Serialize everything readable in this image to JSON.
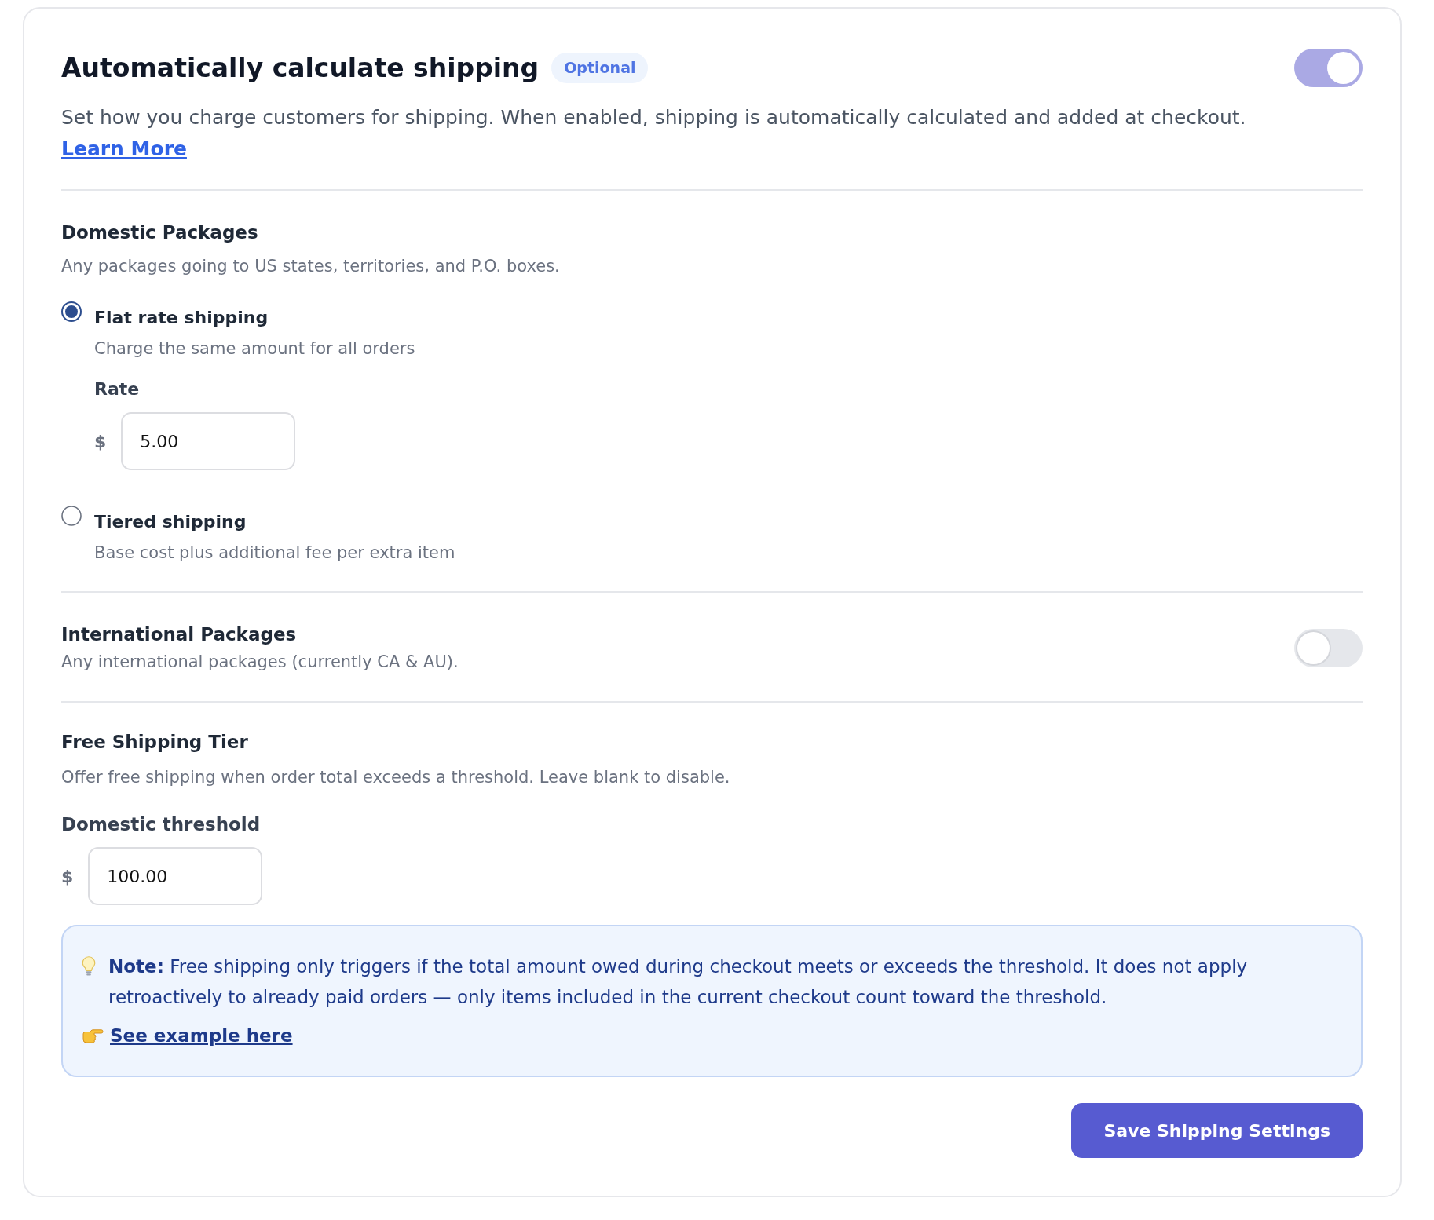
{
  "header": {
    "title": "Automatically calculate shipping",
    "badge": "Optional",
    "enabled": true
  },
  "description": {
    "text": "Set how you charge customers for shipping. When enabled, shipping is automatically calculated and added at checkout.",
    "link": "Learn More"
  },
  "domestic": {
    "title": "Domestic Packages",
    "subtitle": "Any packages going to US states, territories, and P.O. boxes.",
    "options": [
      {
        "label": "Flat rate shipping",
        "hint": "Charge the same amount for all orders",
        "selected": true,
        "rate": {
          "label": "Rate",
          "currency": "$",
          "value": "5.00"
        }
      },
      {
        "label": "Tiered shipping",
        "hint": "Base cost plus additional fee per extra item",
        "selected": false
      }
    ]
  },
  "international": {
    "title": "International Packages",
    "subtitle": "Any international packages (currently CA & AU).",
    "enabled": false
  },
  "free_shipping": {
    "title": "Free Shipping Tier",
    "subtitle": "Offer free shipping when order total exceeds a threshold. Leave blank to disable.",
    "threshold": {
      "label": "Domestic threshold",
      "currency": "$",
      "value": "100.00"
    }
  },
  "note": {
    "text": "**Note:** Free shipping only triggers if the total amount owed during checkout meets or exceeds the threshold. It does not apply retroactively to already paid orders — only items included in the current checkout count toward the threshold.",
    "link": "See example here"
  },
  "save_button": "Save Shipping Settings"
}
